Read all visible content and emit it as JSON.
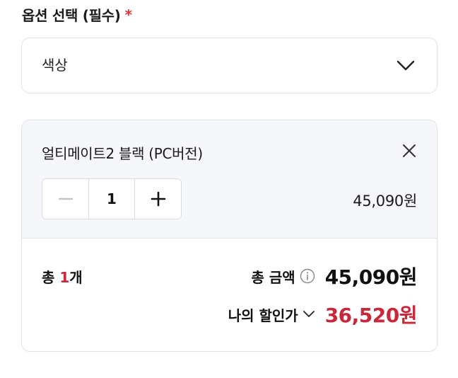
{
  "option_section": {
    "title": "옵션 선택 (필수)",
    "required_mark": "*"
  },
  "select": {
    "value": "색상",
    "icon": "chevron-down-icon"
  },
  "selected_item": {
    "name": "얼티메이트2 블랙 (PC버전)",
    "quantity": "1",
    "price": "45,090원",
    "remove_icon": "close-icon",
    "decrement_icon": "minus-icon",
    "increment_icon": "plus-icon"
  },
  "summary": {
    "count_prefix": "총 ",
    "count_value": "1",
    "count_suffix": "개",
    "total_label": "총 금액",
    "total_amount": "45,090원",
    "discount_label": "나의 할인가",
    "discount_amount": "36,520원"
  },
  "colors": {
    "accent_red": "#c8283a",
    "required_red": "#e0323a",
    "item_background": "#f5f7fb",
    "border": "#e1e3e7"
  }
}
